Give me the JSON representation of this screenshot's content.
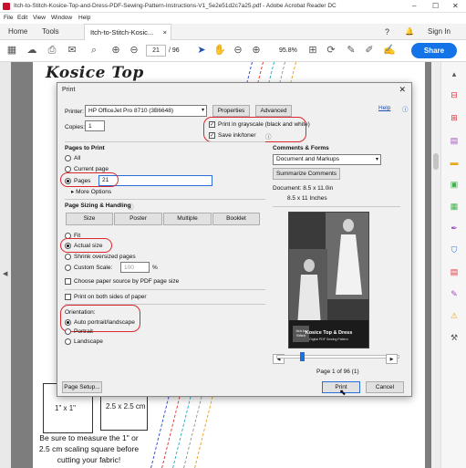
{
  "window": {
    "title": "Itch-to-Stitch-Kosice-Top-and-Dress-PDF-Sewing-Pattern-Instructions-V1_5e2e51d2c7a25.pdf - Adobe Acrobat Reader DC",
    "minimize": "–",
    "maximize": "☐",
    "close": "✕"
  },
  "menu": [
    "File",
    "Edit",
    "View",
    "Window",
    "Help"
  ],
  "tabs": {
    "home": "Home",
    "tools": "Tools",
    "doc": "Itch-to-Stitch-Kosic...",
    "doc_close": "×",
    "help": "?",
    "bell": "🔔",
    "signin": "Sign In"
  },
  "toolbar": {
    "page_current": "21",
    "page_total": "/ 96",
    "zoom": "95.8%",
    "share": "Share"
  },
  "document": {
    "title": "Kosice Top",
    "square_in": "1\" x 1\"",
    "square_cm": "2.5 x 2.5 cm",
    "measure_text": "Be sure to measure the 1\" or 2.5 cm scaling square before cutting your fabric!"
  },
  "dialog": {
    "title": "Print",
    "close": "✕",
    "help": "Help",
    "printer_label": "Printer:",
    "printer_value": "HP OfficeJet Pro 8710 (3B6648)",
    "properties": "Properties",
    "advanced": "Advanced",
    "copies_label": "Copies:",
    "copies_value": "1",
    "grayscale": "Print in grayscale (black and white)",
    "save_ink": "Save ink/toner",
    "pages_heading": "Pages to Print",
    "all": "All",
    "current_page": "Current page",
    "pages": "Pages",
    "pages_value": "21",
    "more_options": "More Options",
    "sizing_heading": "Page Sizing & Handling",
    "size_btn": "Size",
    "poster_btn": "Poster",
    "multiple_btn": "Multiple",
    "booklet_btn": "Booklet",
    "fit": "Fit",
    "actual_size": "Actual size",
    "shrink": "Shrink oversized pages",
    "custom_scale": "Custom Scale:",
    "custom_scale_value": "100",
    "percent": "%",
    "choose_source": "Choose paper source by PDF page size",
    "both_sides": "Print on both sides of paper",
    "orientation_heading": "Orientation:",
    "auto": "Auto portrait/landscape",
    "portrait": "Portrait",
    "landscape": "Landscape",
    "comments_heading": "Comments & Forms",
    "comments_value": "Document and Markups",
    "summarize": "Summarize Comments",
    "doc_size": "Document: 8.5 x 11.0in",
    "paper_size": "8.5 x 11 Inches",
    "preview_title": "Kosice Top & Dress",
    "preview_sub": "Digital PDF Sewing Pattern",
    "preview_logo": "Itch to Stitch",
    "page_of": "Page 1 of 96 (1)",
    "page_setup": "Page Setup...",
    "print": "Print",
    "cancel": "Cancel"
  },
  "colors": {
    "accent": "#1473e6",
    "annotation": "#d9282e"
  }
}
